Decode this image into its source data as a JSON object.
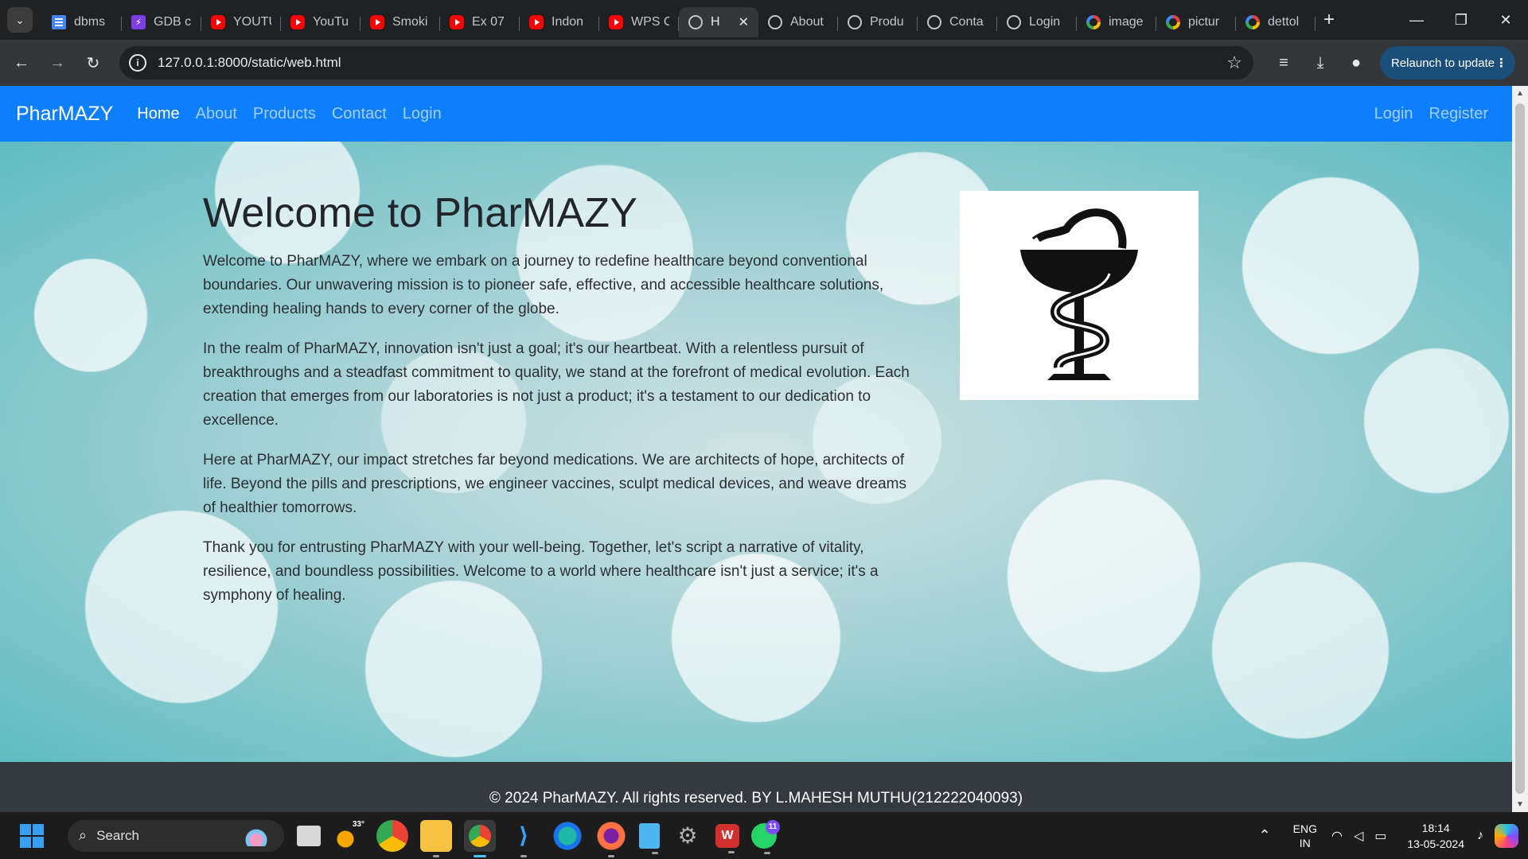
{
  "browser": {
    "tabs": [
      {
        "title": "dbms",
        "icon": "docs-icon"
      },
      {
        "title": "GDB c",
        "icon": "gdb-icon"
      },
      {
        "title": "YOUTU",
        "icon": "youtube-icon"
      },
      {
        "title": "YouTu",
        "icon": "youtube-icon"
      },
      {
        "title": "Smoki",
        "icon": "youtube-icon"
      },
      {
        "title": "Ex 07",
        "icon": "youtube-icon"
      },
      {
        "title": "Indon",
        "icon": "youtube-icon"
      },
      {
        "title": "WPS C",
        "icon": "youtube-icon"
      },
      {
        "title": "H",
        "icon": "globe-icon",
        "active": true
      },
      {
        "title": "About",
        "icon": "globe-icon"
      },
      {
        "title": "Produ",
        "icon": "globe-icon"
      },
      {
        "title": "Conta",
        "icon": "globe-icon"
      },
      {
        "title": "Login",
        "icon": "globe-icon"
      },
      {
        "title": "image",
        "icon": "google-icon"
      },
      {
        "title": "pictur",
        "icon": "google-icon"
      },
      {
        "title": "dettol",
        "icon": "google-icon"
      }
    ],
    "url": "127.0.0.1:8000/static/web.html",
    "relaunch_label": "Relaunch to update"
  },
  "site": {
    "brand": "PharMAZY",
    "nav": [
      {
        "label": "Home",
        "active": true
      },
      {
        "label": "About"
      },
      {
        "label": "Products"
      },
      {
        "label": "Contact"
      },
      {
        "label": "Login"
      }
    ],
    "nav_right": [
      {
        "label": "Login"
      },
      {
        "label": "Register"
      }
    ],
    "hero": {
      "title": "Welcome to PharMAZY",
      "paragraphs": [
        "Welcome to PharMAZY, where we embark on a journey to redefine healthcare beyond conventional boundaries. Our unwavering mission is to pioneer safe, effective, and accessible healthcare solutions, extending healing hands to every corner of the globe.",
        "In the realm of PharMAZY, innovation isn't just a goal; it's our heartbeat. With a relentless pursuit of breakthroughs and a steadfast commitment to quality, we stand at the forefront of medical evolution. Each creation that emerges from our laboratories is not just a product; it's a testament to our dedication to excellence.",
        "Here at PharMAZY, our impact stretches far beyond medications. We are architects of hope, architects of life. Beyond the pills and prescriptions, we engineer vaccines, sculpt medical devices, and weave dreams of healthier tomorrows.",
        "Thank you for entrusting PharMAZY with your well-being. Together, let's script a narrative of vitality, resilience, and boundless possibilities. Welcome to a world where healthcare isn't just a service; it's a symphony of healing."
      ]
    },
    "footer": "© 2024 PharMAZY. All rights reserved. BY L.MAHESH MUTHU(212222040093)",
    "colors": {
      "navbar": "#0d7ffc",
      "footer": "#343a40"
    }
  },
  "taskbar": {
    "search_placeholder": "Search",
    "weather_temp": "33°",
    "whatsapp_badge": "11",
    "lang_line1": "ENG",
    "lang_line2": "IN",
    "time": "18:14",
    "date": "13-05-2024"
  }
}
